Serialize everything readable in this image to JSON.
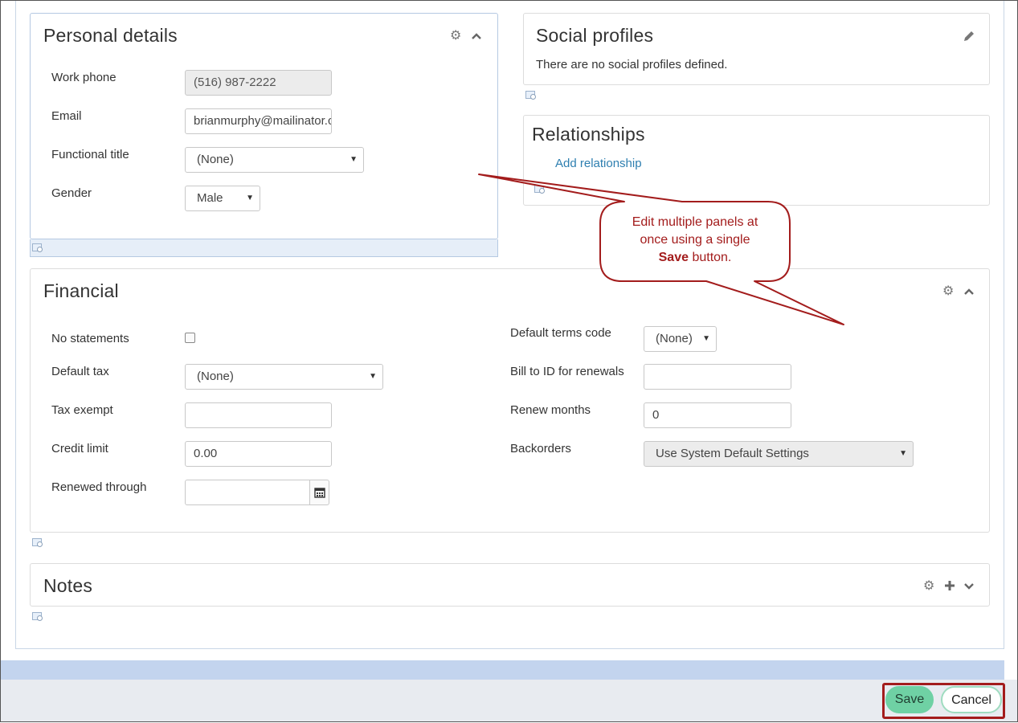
{
  "personal_details": {
    "title": "Personal details",
    "fields": {
      "work_phone_label": "Work phone",
      "work_phone_value": "(516) 987-2222",
      "email_label": "Email",
      "email_value": "brianmurphy@mailinator.com",
      "functional_title_label": "Functional title",
      "functional_title_value": "(None)",
      "gender_label": "Gender",
      "gender_value": "Male"
    }
  },
  "social_profiles": {
    "title": "Social profiles",
    "empty_message": "There are no social profiles defined."
  },
  "relationships": {
    "title": "Relationships",
    "add_link": "Add relationship"
  },
  "financial": {
    "title": "Financial",
    "no_statements_label": "No statements",
    "default_tax_label": "Default tax",
    "default_tax_value": "(None)",
    "tax_exempt_label": "Tax exempt",
    "tax_exempt_value": "",
    "credit_limit_label": "Credit limit",
    "credit_limit_value": "0.00",
    "renewed_through_label": "Renewed through",
    "renewed_through_value": "",
    "default_terms_code_label": "Default terms code",
    "default_terms_code_value": "(None)",
    "bill_to_label": "Bill to ID for renewals",
    "bill_to_value": "",
    "renew_months_label": "Renew months",
    "renew_months_value": "0",
    "backorders_label": "Backorders",
    "backorders_value": "Use System Default Settings"
  },
  "notes": {
    "title": "Notes"
  },
  "callout": {
    "line1": "Edit multiple panels at",
    "line2": "once using a single",
    "line3_bold": "Save",
    "line3_rest": " button."
  },
  "footer": {
    "save_label": "Save",
    "cancel_label": "Cancel"
  },
  "colors": {
    "save_button": "#6fd1a4",
    "callout_border": "#a31c1c",
    "highlight_border": "#a31c1c",
    "link": "#2e7fb0"
  },
  "icons": [
    "gear-icon",
    "chevron-up-icon",
    "chevron-down-icon",
    "plus-icon",
    "pencil-icon",
    "calendar-icon",
    "panel-edit-icon"
  ]
}
